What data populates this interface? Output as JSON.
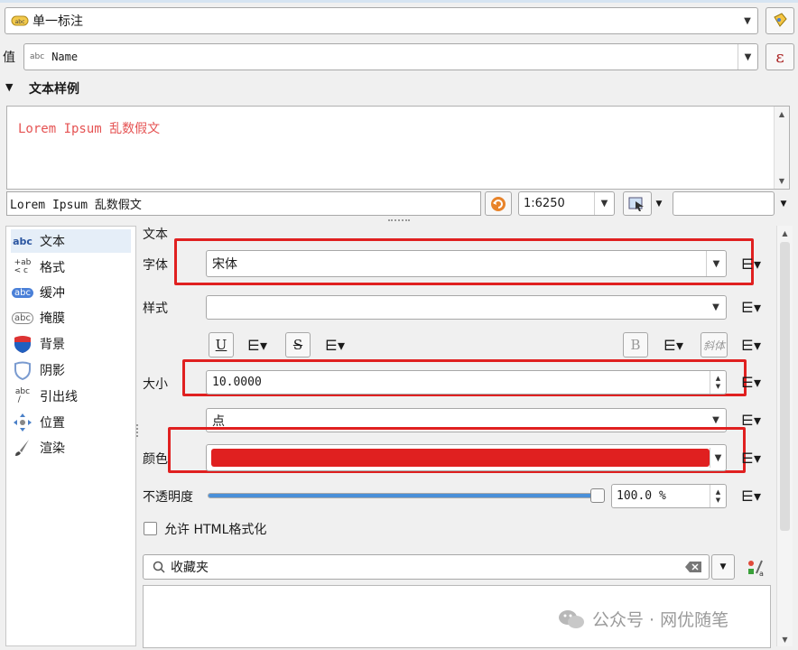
{
  "label_mode": {
    "value": "单一标注"
  },
  "value_field": {
    "label": "值",
    "type_hint": "abc",
    "value": "Name",
    "expr_symbol": "ε"
  },
  "text_sample": {
    "header": "文本样例",
    "preview_text": "Lorem Ipsum 乱数假文",
    "preview_color": "#e55353",
    "sample_input": "Lorem Ipsum 乱数假文",
    "scale": "1:6250"
  },
  "sidebar": {
    "items": [
      {
        "label": "文本",
        "icon": "text-abc-icon"
      },
      {
        "label": "格式",
        "icon": "format-abc-icon"
      },
      {
        "label": "缓冲",
        "icon": "buffer-abc-icon"
      },
      {
        "label": "掩膜",
        "icon": "mask-abc-icon"
      },
      {
        "label": "背景",
        "icon": "background-shield-icon"
      },
      {
        "label": "阴影",
        "icon": "shadow-icon"
      },
      {
        "label": "引出线",
        "icon": "callout-icon"
      },
      {
        "label": "位置",
        "icon": "placement-icon"
      },
      {
        "label": "渲染",
        "icon": "rendering-brush-icon"
      }
    ]
  },
  "text_panel": {
    "section_title": "文本",
    "font_label": "字体",
    "font_value": "宋体",
    "style_label": "样式",
    "style_value": "",
    "underline_label": "U",
    "strikeout_label": "S",
    "bold_label": "B",
    "italic_label": "斜体",
    "size_label": "大小",
    "size_value": "10.0000",
    "unit_value": "点",
    "color_label": "颜色",
    "color_value": "#e02020",
    "opacity_label": "不透明度",
    "opacity_value": "100.0 %",
    "opacity_fraction": 1.0,
    "html_label": "允许 HTML格式化",
    "html_checked": false,
    "search_placeholder": "收藏夹"
  },
  "watermark": {
    "text": "公众号 · 网优随笔"
  }
}
